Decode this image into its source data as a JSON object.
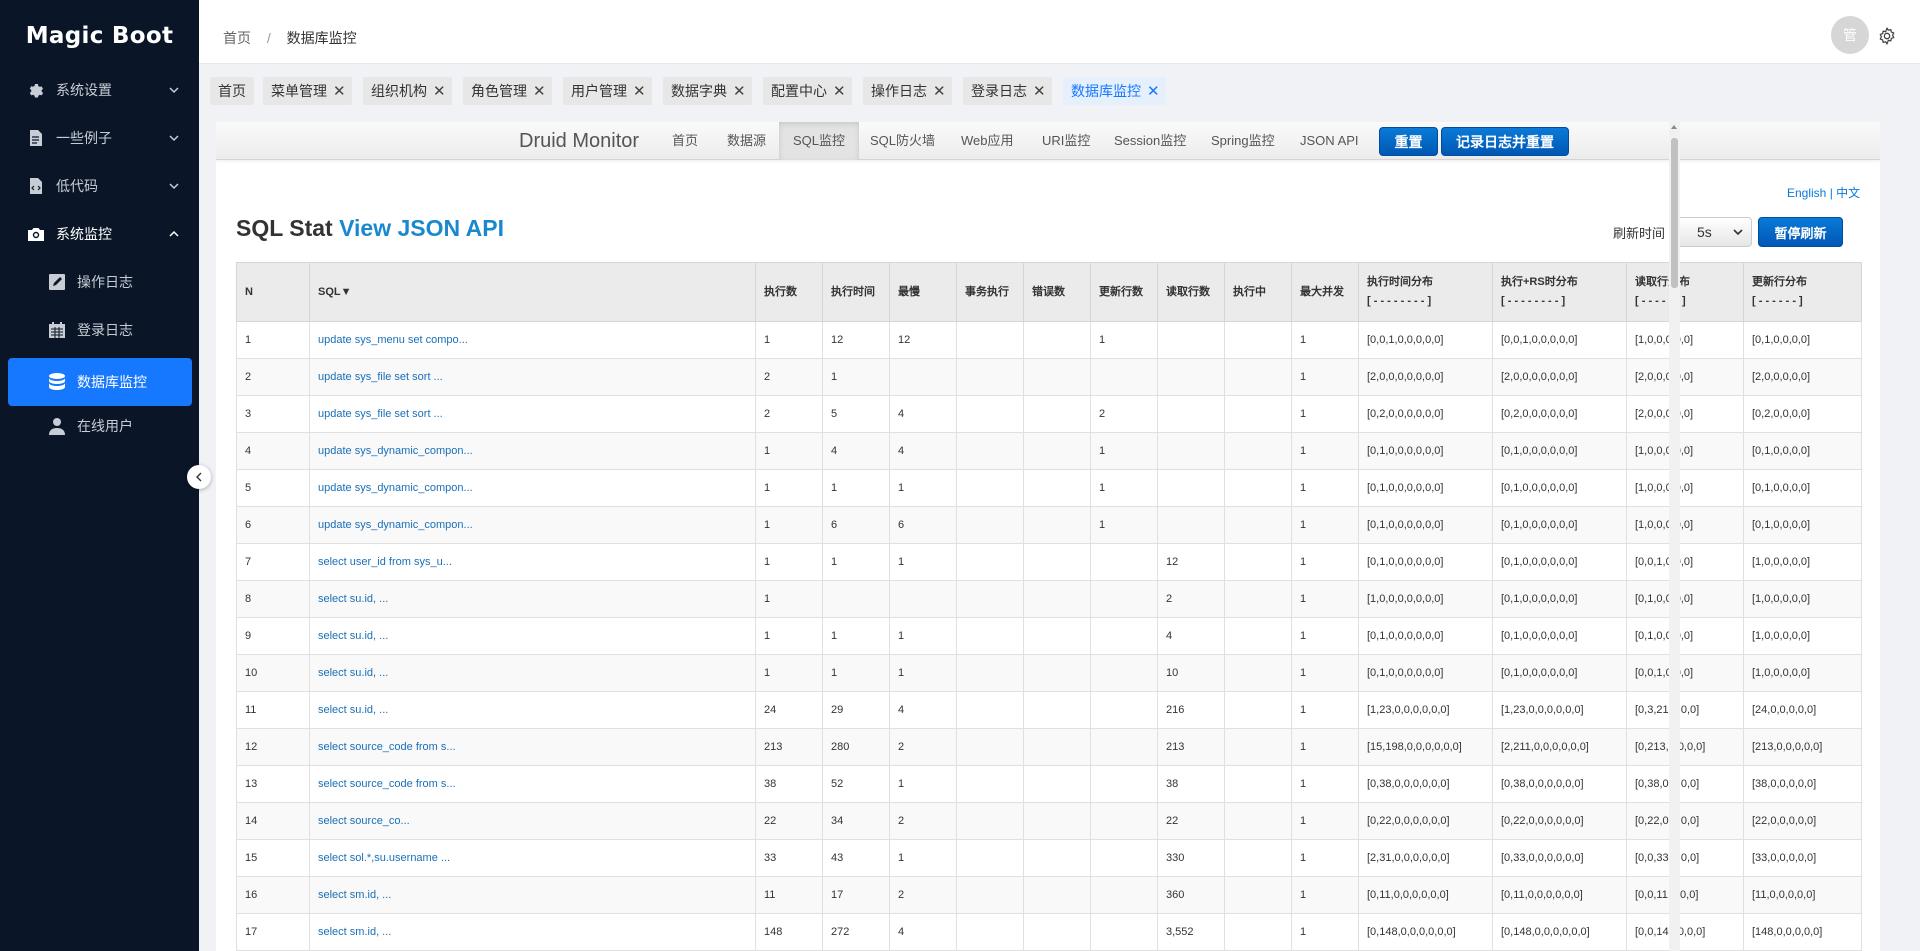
{
  "app": {
    "logo": "Magic Boot"
  },
  "sidebar": {
    "items": [
      {
        "label": "系统设置",
        "icon": "gear-icon"
      },
      {
        "label": "一些例子",
        "icon": "document-icon"
      },
      {
        "label": "低代码",
        "icon": "code-file-icon"
      },
      {
        "label": "系统监控",
        "icon": "camera-icon"
      }
    ],
    "subitems": [
      {
        "label": "操作日志",
        "icon": "edit-icon"
      },
      {
        "label": "登录日志",
        "icon": "calendar-icon"
      },
      {
        "label": "数据库监控",
        "icon": "database-icon"
      },
      {
        "label": "在线用户",
        "icon": "user-icon"
      }
    ]
  },
  "header": {
    "breadcrumb": [
      "首页",
      "数据库监控"
    ],
    "avatar_text": "管"
  },
  "tabs": [
    "首页",
    "菜单管理",
    "组织机构",
    "角色管理",
    "用户管理",
    "数据字典",
    "配置中心",
    "操作日志",
    "登录日志",
    "数据库监控"
  ],
  "druid": {
    "brand": "Druid Monitor",
    "nav": [
      "首页",
      "数据源",
      "SQL监控",
      "SQL防火墙",
      "Web应用",
      "URI监控",
      "Session监控",
      "Spring监控",
      "JSON API"
    ],
    "reset_btn": "重置",
    "log_reset_btn": "记录日志并重置",
    "lang_en": "English",
    "lang_sep": "|",
    "lang_zh": "中文",
    "heading": "SQL Stat",
    "heading_link": "View JSON API",
    "refresh_label": "刷新时间",
    "refresh_value": "5s",
    "pause_btn": "暂停刷新"
  },
  "table": {
    "headers": [
      [
        "N",
        ""
      ],
      [
        "SQL▼",
        ""
      ],
      [
        "执行数",
        ""
      ],
      [
        "执行时间",
        ""
      ],
      [
        "最慢",
        ""
      ],
      [
        "事务执行",
        ""
      ],
      [
        "错误数",
        ""
      ],
      [
        "更新行数",
        ""
      ],
      [
        "读取行数",
        ""
      ],
      [
        "执行中",
        ""
      ],
      [
        "最大并发",
        ""
      ],
      [
        "执行时间分布",
        "[ - - - - - - - - ]"
      ],
      [
        "执行+RS时分布",
        "[ - - - - - - - - ]"
      ],
      [
        "读取行分布",
        "[ - - - - - - ]"
      ],
      [
        "更新行分布",
        "[ - - - - - - ]"
      ]
    ],
    "rows": [
      [
        "1",
        "update sys_menu set compo...",
        "1",
        "12",
        "12",
        "",
        "",
        "1",
        "",
        "",
        "1",
        "[0,0,1,0,0,0,0,0]",
        "[0,0,1,0,0,0,0,0]",
        "[1,0,0,0,0,0]",
        "[0,1,0,0,0,0]"
      ],
      [
        "2",
        "update sys_file set sort ...",
        "2",
        "1",
        "",
        "",
        "",
        "",
        "",
        "",
        "1",
        "[2,0,0,0,0,0,0,0]",
        "[2,0,0,0,0,0,0,0]",
        "[2,0,0,0,0,0]",
        "[2,0,0,0,0,0]"
      ],
      [
        "3",
        "update sys_file set sort ...",
        "2",
        "5",
        "4",
        "",
        "",
        "2",
        "",
        "",
        "1",
        "[0,2,0,0,0,0,0,0]",
        "[0,2,0,0,0,0,0,0]",
        "[2,0,0,0,0,0]",
        "[0,2,0,0,0,0]"
      ],
      [
        "4",
        "update sys_dynamic_compon...",
        "1",
        "4",
        "4",
        "",
        "",
        "1",
        "",
        "",
        "1",
        "[0,1,0,0,0,0,0,0]",
        "[0,1,0,0,0,0,0,0]",
        "[1,0,0,0,0,0]",
        "[0,1,0,0,0,0]"
      ],
      [
        "5",
        "update sys_dynamic_compon...",
        "1",
        "1",
        "1",
        "",
        "",
        "1",
        "",
        "",
        "1",
        "[0,1,0,0,0,0,0,0]",
        "[0,1,0,0,0,0,0,0]",
        "[1,0,0,0,0,0]",
        "[0,1,0,0,0,0]"
      ],
      [
        "6",
        "update sys_dynamic_compon...",
        "1",
        "6",
        "6",
        "",
        "",
        "1",
        "",
        "",
        "1",
        "[0,1,0,0,0,0,0,0]",
        "[0,1,0,0,0,0,0,0]",
        "[1,0,0,0,0,0]",
        "[0,1,0,0,0,0]"
      ],
      [
        "7",
        "select user_id from sys_u...",
        "1",
        "1",
        "1",
        "",
        "",
        "",
        "12",
        "",
        "1",
        "[0,1,0,0,0,0,0,0]",
        "[0,1,0,0,0,0,0,0]",
        "[0,0,1,0,0,0]",
        "[1,0,0,0,0,0]"
      ],
      [
        "8",
        "select su.id, ...",
        "1",
        "",
        "",
        "",
        "",
        "",
        "2",
        "",
        "1",
        "[1,0,0,0,0,0,0,0]",
        "[0,1,0,0,0,0,0,0]",
        "[0,1,0,0,0,0]",
        "[1,0,0,0,0,0]"
      ],
      [
        "9",
        "select su.id, ...",
        "1",
        "1",
        "1",
        "",
        "",
        "",
        "4",
        "",
        "1",
        "[0,1,0,0,0,0,0,0]",
        "[0,1,0,0,0,0,0,0]",
        "[0,1,0,0,0,0]",
        "[1,0,0,0,0,0]"
      ],
      [
        "10",
        "select su.id, ...",
        "1",
        "1",
        "1",
        "",
        "",
        "",
        "10",
        "",
        "1",
        "[0,1,0,0,0,0,0,0]",
        "[0,1,0,0,0,0,0,0]",
        "[0,0,1,0,0,0]",
        "[1,0,0,0,0,0]"
      ],
      [
        "11",
        "select su.id, ...",
        "24",
        "29",
        "4",
        "",
        "",
        "",
        "216",
        "",
        "1",
        "[1,23,0,0,0,0,0,0]",
        "[1,23,0,0,0,0,0,0]",
        "[0,3,21,0,0,0]",
        "[24,0,0,0,0,0]"
      ],
      [
        "12",
        "select source_code from s...",
        "213",
        "280",
        "2",
        "",
        "",
        "",
        "213",
        "",
        "1",
        "[15,198,0,0,0,0,0,0]",
        "[2,211,0,0,0,0,0,0]",
        "[0,213,0,0,0,0]",
        "[213,0,0,0,0,0]"
      ],
      [
        "13",
        "select source_code from s...",
        "38",
        "52",
        "1",
        "",
        "",
        "",
        "38",
        "",
        "1",
        "[0,38,0,0,0,0,0,0]",
        "[0,38,0,0,0,0,0,0]",
        "[0,38,0,0,0,0]",
        "[38,0,0,0,0,0]"
      ],
      [
        "14",
        "select source_co...",
        "22",
        "34",
        "2",
        "",
        "",
        "",
        "22",
        "",
        "1",
        "[0,22,0,0,0,0,0,0]",
        "[0,22,0,0,0,0,0,0]",
        "[0,22,0,0,0,0]",
        "[22,0,0,0,0,0]"
      ],
      [
        "15",
        "select sol.*,su.username ...",
        "33",
        "43",
        "1",
        "",
        "",
        "",
        "330",
        "",
        "1",
        "[2,31,0,0,0,0,0,0]",
        "[0,33,0,0,0,0,0,0]",
        "[0,0,33,0,0,0]",
        "[33,0,0,0,0,0]"
      ],
      [
        "16",
        "select sm.id, ...",
        "11",
        "17",
        "2",
        "",
        "",
        "",
        "360",
        "",
        "1",
        "[0,11,0,0,0,0,0,0]",
        "[0,11,0,0,0,0,0,0]",
        "[0,0,11,0,0,0]",
        "[11,0,0,0,0,0]"
      ],
      [
        "17",
        "select sm.id, ...",
        "148",
        "272",
        "4",
        "",
        "",
        "",
        "3,552",
        "",
        "1",
        "[0,148,0,0,0,0,0,0]",
        "[0,148,0,0,0,0,0,0]",
        "[0,0,148,0,0,0]",
        "[148,0,0,0,0,0]"
      ]
    ]
  }
}
